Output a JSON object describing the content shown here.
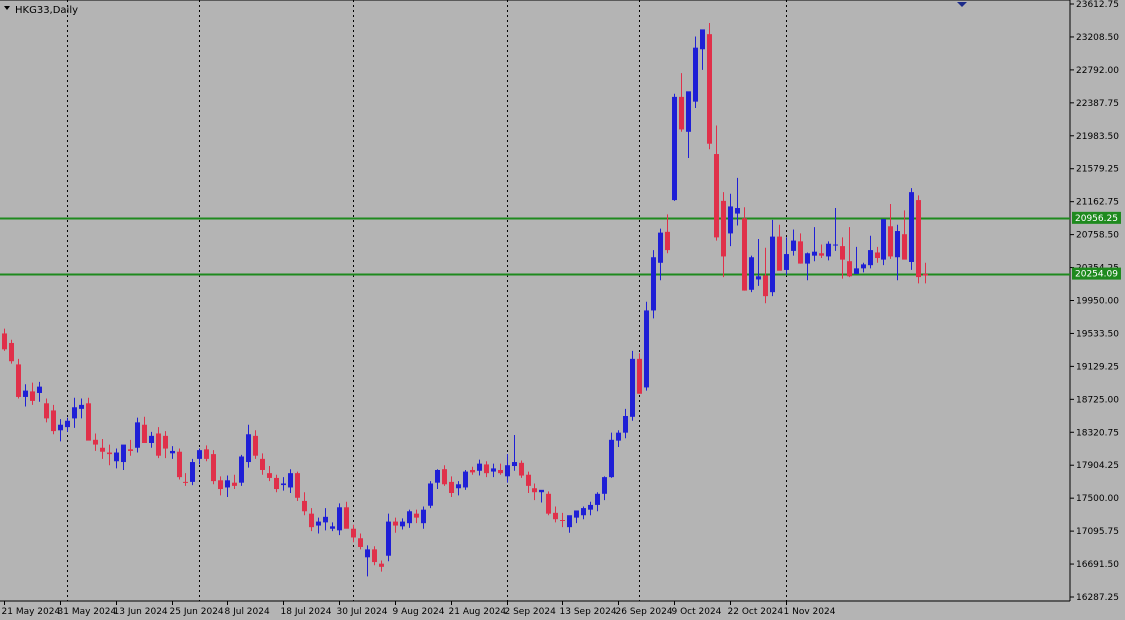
{
  "chart_data": {
    "type": "candlestick",
    "title": "HKG33,Daily",
    "colors": {
      "background": "#b4b4b4",
      "bull": "#1f1fd6",
      "bear": "#e0304a",
      "level_line": "#1e8a1e",
      "level_label_bg": "#1e8a1e",
      "grid_line": "#000000",
      "axis": "#000000",
      "marker": "#1c2b8a"
    },
    "ylim": [
      16180,
      23650
    ],
    "y_ticks": [
      "23612.75",
      "23208.50",
      "22792.00",
      "22387.75",
      "21983.50",
      "21579.25",
      "21162.75",
      "20758.50",
      "20354.25",
      "19950.00",
      "19533.50",
      "19129.25",
      "18725.00",
      "18320.75",
      "17904.25",
      "17500.00",
      "17095.75",
      "16691.50",
      "16287.25"
    ],
    "x_ticks": [
      "21 May 2024",
      "31 May 2024",
      "13 Jun 2024",
      "25 Jun 2024",
      "8 Jul 2024",
      "18 Jul 2024",
      "30 Jul 2024",
      "9 Aug 2024",
      "21 Aug 2024",
      "2 Sep 2024",
      "13 Sep 2024",
      "26 Sep 2024",
      "9 Oct 2024",
      "22 Oct 2024",
      "1 Nov 2024"
    ],
    "x_tick_index": [
      0,
      8,
      16,
      24,
      32,
      40,
      48,
      56,
      64,
      72,
      80,
      88,
      96,
      104,
      112
    ],
    "grid": "vertical dotted lines at month starts",
    "month_separators": [
      "31 May 2024",
      "25 Jun 2024",
      "30 Jul 2024",
      "2 Sep 2024",
      "26 Sep 2024",
      "1 Nov 2024"
    ],
    "month_separator_index": [
      9,
      28,
      50,
      72,
      91,
      112
    ],
    "levels": [
      {
        "label": "20956.25",
        "value": 20956.25
      },
      {
        "label": "20254.09",
        "value": 20254.09
      }
    ],
    "candles": [
      [
        19500,
        19560,
        19280,
        19300
      ],
      [
        19380,
        19420,
        19120,
        19150
      ],
      [
        19110,
        19180,
        18680,
        18700
      ],
      [
        18700,
        18860,
        18580,
        18780
      ],
      [
        18770,
        18880,
        18600,
        18650
      ],
      [
        18750,
        18890,
        18640,
        18830
      ],
      [
        18620,
        18680,
        18380,
        18430
      ],
      [
        18530,
        18600,
        18230,
        18270
      ],
      [
        18280,
        18420,
        18140,
        18350
      ],
      [
        18320,
        18440,
        18260,
        18400
      ],
      [
        18430,
        18690,
        18310,
        18570
      ],
      [
        18550,
        18680,
        18430,
        18600
      ],
      [
        18620,
        18690,
        18230,
        18150
      ],
      [
        18160,
        18240,
        18020,
        18100
      ],
      [
        18060,
        18170,
        17920,
        18010
      ],
      [
        18000,
        18100,
        17840,
        17980
      ],
      [
        17890,
        18050,
        17800,
        18000
      ],
      [
        17880,
        18080,
        17780,
        18100
      ],
      [
        18040,
        18160,
        17960,
        18020
      ],
      [
        18060,
        18440,
        18000,
        18380
      ],
      [
        18350,
        18450,
        18160,
        18120
      ],
      [
        18120,
        18260,
        18060,
        18210
      ],
      [
        18240,
        18320,
        17930,
        17960
      ],
      [
        18210,
        18270,
        17930,
        18050
      ],
      [
        17990,
        18080,
        17920,
        18020
      ],
      [
        18010,
        18050,
        17660,
        17690
      ],
      [
        17630,
        17740,
        17580,
        17620
      ],
      [
        17630,
        17920,
        17590,
        17880
      ],
      [
        17920,
        18050,
        17850,
        18030
      ],
      [
        18040,
        18090,
        17890,
        17920
      ],
      [
        17980,
        18030,
        17600,
        17640
      ],
      [
        17650,
        17700,
        17460,
        17540
      ],
      [
        17560,
        17710,
        17440,
        17650
      ],
      [
        17620,
        17720,
        17540,
        17580
      ],
      [
        17620,
        17970,
        17580,
        17950
      ],
      [
        17880,
        18350,
        17810,
        18230
      ],
      [
        18210,
        18280,
        17920,
        17960
      ],
      [
        17920,
        17990,
        17720,
        17780
      ],
      [
        17740,
        17830,
        17640,
        17680
      ],
      [
        17680,
        17720,
        17500,
        17540
      ],
      [
        17590,
        17690,
        17520,
        17610
      ],
      [
        17560,
        17790,
        17490,
        17740
      ],
      [
        17740,
        17760,
        17390,
        17430
      ],
      [
        17390,
        17500,
        17210,
        17260
      ],
      [
        17230,
        17300,
        17010,
        17060
      ],
      [
        17080,
        17180,
        16980,
        17130
      ],
      [
        17120,
        17300,
        17020,
        17190
      ],
      [
        17040,
        17120,
        17010,
        17070
      ],
      [
        17020,
        17360,
        16960,
        17310
      ],
      [
        17310,
        17380,
        17060,
        17040
      ],
      [
        17040,
        17090,
        16870,
        16930
      ],
      [
        16920,
        16980,
        16780,
        16810
      ],
      [
        16680,
        16830,
        16440,
        16780
      ],
      [
        16780,
        16820,
        16580,
        16620
      ],
      [
        16600,
        16640,
        16500,
        16560
      ],
      [
        16700,
        17230,
        16630,
        17130
      ],
      [
        17130,
        17180,
        16990,
        17080
      ],
      [
        17070,
        17170,
        17030,
        17130
      ],
      [
        17110,
        17280,
        17050,
        17260
      ],
      [
        17230,
        17280,
        17110,
        17180
      ],
      [
        17110,
        17320,
        17040,
        17280
      ],
      [
        17330,
        17640,
        17300,
        17610
      ],
      [
        17620,
        17790,
        17540,
        17780
      ],
      [
        17790,
        17840,
        17580,
        17600
      ],
      [
        17630,
        17700,
        17440,
        17490
      ],
      [
        17550,
        17640,
        17460,
        17600
      ],
      [
        17560,
        17780,
        17530,
        17760
      ],
      [
        17780,
        17820,
        17720,
        17750
      ],
      [
        17770,
        17910,
        17710,
        17860
      ],
      [
        17850,
        17890,
        17690,
        17740
      ],
      [
        17760,
        17860,
        17690,
        17800
      ],
      [
        17780,
        17860,
        17720,
        17740
      ],
      [
        17700,
        17980,
        17620,
        17840
      ],
      [
        17830,
        18220,
        17770,
        17880
      ],
      [
        17870,
        17900,
        17680,
        17710
      ],
      [
        17720,
        17760,
        17490,
        17580
      ],
      [
        17550,
        17610,
        17400,
        17500
      ],
      [
        17500,
        17520,
        17370,
        17530
      ],
      [
        17480,
        17510,
        17210,
        17230
      ],
      [
        17240,
        17320,
        17120,
        17160
      ],
      [
        17150,
        17240,
        17060,
        17140
      ],
      [
        17060,
        17140,
        16990,
        17210
      ],
      [
        17180,
        17260,
        17110,
        17270
      ],
      [
        17210,
        17320,
        17160,
        17300
      ],
      [
        17280,
        17380,
        17210,
        17340
      ],
      [
        17340,
        17500,
        17260,
        17480
      ],
      [
        17480,
        17700,
        17400,
        17690
      ],
      [
        17690,
        18250,
        17680,
        18160
      ],
      [
        18150,
        18280,
        18070,
        18250
      ],
      [
        18250,
        18550,
        18180,
        18460
      ],
      [
        18450,
        19280,
        18400,
        19180
      ],
      [
        19180,
        19250,
        18760,
        18740
      ],
      [
        18820,
        19900,
        18780,
        19790
      ],
      [
        19790,
        20550,
        19690,
        20460
      ],
      [
        20390,
        20820,
        20170,
        20770
      ],
      [
        20780,
        21000,
        20510,
        20550
      ],
      [
        21180,
        22520,
        21170,
        22480
      ],
      [
        22480,
        22780,
        22040,
        22070
      ],
      [
        22040,
        22520,
        21710,
        22550
      ],
      [
        22420,
        23240,
        22340,
        23100
      ],
      [
        23080,
        23310,
        22820,
        23330
      ],
      [
        23270,
        23410,
        21820,
        21890
      ],
      [
        21760,
        22120,
        20670,
        20710
      ],
      [
        21170,
        21280,
        20210,
        20470
      ],
      [
        20760,
        21260,
        20600,
        21100
      ],
      [
        21010,
        21460,
        20860,
        21080
      ],
      [
        20950,
        21090,
        20040,
        20040
      ],
      [
        20050,
        20480,
        20020,
        20460
      ],
      [
        20180,
        20690,
        20100,
        20220
      ],
      [
        20230,
        20580,
        19880,
        19970
      ],
      [
        20020,
        20930,
        19970,
        20720
      ],
      [
        20720,
        20870,
        20370,
        20290
      ],
      [
        20300,
        20710,
        20240,
        20500
      ],
      [
        20540,
        20810,
        20480,
        20670
      ],
      [
        20660,
        20760,
        20380,
        20380
      ],
      [
        20380,
        20520,
        20170,
        20510
      ],
      [
        20480,
        20840,
        20410,
        20530
      ],
      [
        20510,
        20620,
        20450,
        20480
      ],
      [
        20470,
        20660,
        20420,
        20630
      ],
      [
        20620,
        21080,
        20540,
        20620
      ],
      [
        20600,
        20710,
        20190,
        20430
      ],
      [
        20410,
        20840,
        20210,
        20220
      ],
      [
        20250,
        20590,
        20290,
        20320
      ],
      [
        20320,
        20390,
        20270,
        20370
      ],
      [
        20360,
        20730,
        20320,
        20550
      ],
      [
        20520,
        20590,
        20390,
        20450
      ],
      [
        20430,
        20880,
        20360,
        20940
      ],
      [
        20850,
        21130,
        20440,
        20470
      ],
      [
        20460,
        20870,
        20170,
        20790
      ],
      [
        20750,
        21050,
        20540,
        20430
      ],
      [
        20400,
        21330,
        20300,
        21280
      ],
      [
        21180,
        21240,
        20130,
        20210
      ],
      [
        20250,
        20390,
        20130,
        20230
      ]
    ]
  }
}
